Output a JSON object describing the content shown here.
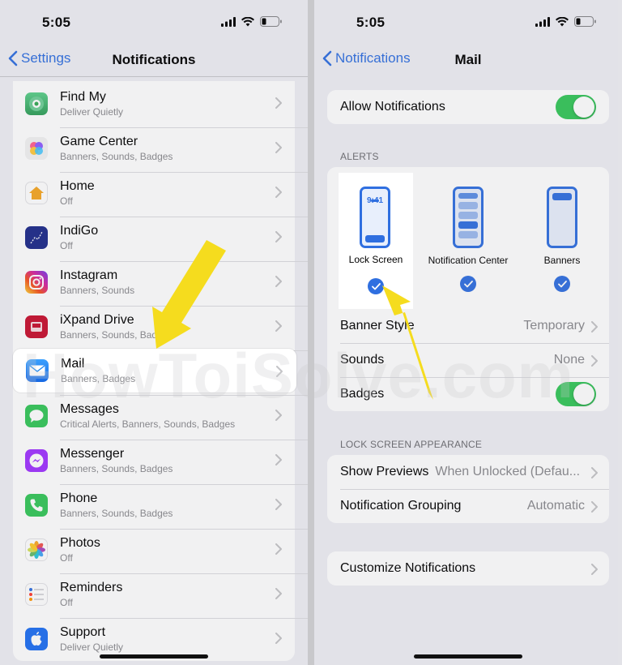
{
  "left": {
    "time": "5:05",
    "back_label": "Settings",
    "title": "Notifications",
    "apps": [
      {
        "name": "Find My",
        "sub": "Deliver Quietly",
        "icon": "find-my-icon",
        "color": "#34a853"
      },
      {
        "name": "Game Center",
        "sub": "Banners, Sounds, Badges",
        "icon": "game-center-icon",
        "color": "#f2f2f2"
      },
      {
        "name": "Home",
        "sub": "Off",
        "icon": "home-icon",
        "color": "#ffffff"
      },
      {
        "name": "IndiGo",
        "sub": "Off",
        "icon": "indigo-icon",
        "color": "#1c2a8a"
      },
      {
        "name": "Instagram",
        "sub": "Banners, Sounds",
        "icon": "instagram-icon",
        "color": "#d6249f"
      },
      {
        "name": "iXpand Drive",
        "sub": "Banners, Sounds, Badges",
        "icon": "ixpand-drive-icon",
        "color": "#c8102e"
      },
      {
        "name": "Mail",
        "sub": "Banners, Badges",
        "icon": "mail-icon",
        "color": "#1e88f0"
      },
      {
        "name": "Messages",
        "sub": "Critical Alerts, Banners, Sounds, Badges",
        "icon": "messages-icon",
        "color": "#34c759"
      },
      {
        "name": "Messenger",
        "sub": "Banners, Sounds, Badges",
        "icon": "messenger-icon",
        "color": "#a033ff"
      },
      {
        "name": "Phone",
        "sub": "Banners, Sounds, Badges",
        "icon": "phone-icon",
        "color": "#34c759"
      },
      {
        "name": "Photos",
        "sub": "Off",
        "icon": "photos-icon",
        "color": "#ffffff"
      },
      {
        "name": "Reminders",
        "sub": "Off",
        "icon": "reminders-icon",
        "color": "#ffffff"
      },
      {
        "name": "Support",
        "sub": "Deliver Quietly",
        "icon": "support-icon",
        "color": "#1d6ff2"
      }
    ]
  },
  "right": {
    "time": "5:05",
    "back_label": "Notifications",
    "title": "Mail",
    "allow_notifications": {
      "label": "Allow Notifications",
      "on": true
    },
    "alerts_header": "ALERTS",
    "alert_options": [
      {
        "label": "Lock Screen",
        "checked": true,
        "preview_time": "9:41"
      },
      {
        "label": "Notification Center",
        "checked": true
      },
      {
        "label": "Banners",
        "checked": true
      }
    ],
    "banner_style": {
      "label": "Banner Style",
      "value": "Temporary"
    },
    "sounds": {
      "label": "Sounds",
      "value": "None"
    },
    "badges": {
      "label": "Badges",
      "on": true
    },
    "lock_screen_header": "LOCK SCREEN APPEARANCE",
    "show_previews": {
      "label": "Show Previews",
      "value": "When Unlocked (Defau..."
    },
    "notification_grouping": {
      "label": "Notification Grouping",
      "value": "Automatic"
    },
    "customize": {
      "label": "Customize Notifications"
    }
  },
  "watermark": "HowToiSolve.com",
  "colors": {
    "accent": "#2f6fe0",
    "arrow": "#f5dc1e",
    "toggle_on": "#34c759"
  }
}
